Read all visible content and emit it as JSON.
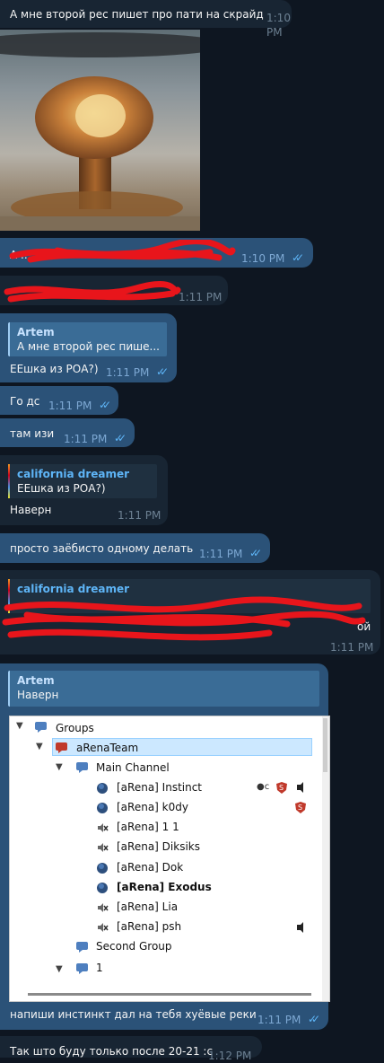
{
  "messages": [
    {
      "text": "А мне второй рес пишет про пати на скрайд",
      "time": "1:10 PM"
    },
    {
      "text": "А ...",
      "time": "1:10 PM",
      "read": "✓✓"
    },
    {
      "time": "1:11 PM"
    },
    {
      "reply_name": "Artem",
      "reply_text": "А мне второй рес пише...",
      "text": "ЕЕшка из РОА?)",
      "time": "1:11 PM",
      "read": "✓✓"
    },
    {
      "text": "Го дс",
      "time": "1:11 PM",
      "read": "✓✓"
    },
    {
      "text": "там изи",
      "time": "1:11 PM",
      "read": "✓✓"
    },
    {
      "reply_name": "california dreamer",
      "reply_text": "ЕЕшка из РОА?)",
      "text": "Наверн",
      "time": "1:11 PM"
    },
    {
      "text": "просто заёбисто одному делать",
      "time": "1:11 PM",
      "read": "✓✓"
    },
    {
      "reply_name": "california dreamer",
      "text_end": "ой",
      "time": "1:11 PM"
    },
    {
      "reply_name": "Artem",
      "reply_text": "Наверн",
      "text": "напиши инстинкт дал на тебя хуёвые реки",
      "time": "1:11 PM",
      "read": "✓✓"
    },
    {
      "text": "Так што буду только после 20-21 :с",
      "time": "1:12 PM"
    }
  ],
  "tree": {
    "groups": "Groups",
    "team": "aRenaTeam",
    "main_channel": "Main Channel",
    "users": [
      {
        "name": "[aRena] Instinct",
        "bold": false
      },
      {
        "name": "[aRena] k0dy",
        "bold": false
      },
      {
        "name": "[aRena] 1 1",
        "bold": false
      },
      {
        "name": "[aRena] Diksiks",
        "bold": false
      },
      {
        "name": "[aRena] Dok",
        "bold": false
      },
      {
        "name": "[aRena] Exodus",
        "bold": true
      },
      {
        "name": "[aRena] Lia",
        "bold": false
      },
      {
        "name": "[aRena] psh",
        "bold": false
      }
    ],
    "second_group": "Second Group",
    "group_1": "1",
    "instinct_badge": "c"
  }
}
